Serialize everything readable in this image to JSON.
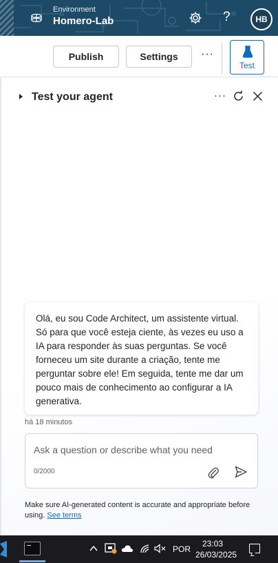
{
  "header": {
    "env_label": "Environment",
    "env_name": "Homero-Lab",
    "help_glyph": "?",
    "avatar_initials": "HB",
    "icons": {
      "environment": "globe-icon",
      "settings": "gear-icon",
      "help": "question-icon"
    }
  },
  "toolbar": {
    "publish_label": "Publish",
    "settings_label": "Settings",
    "more_glyph": "···",
    "test_label": "Test"
  },
  "panel": {
    "title": "Test your agent",
    "more_glyph": "···",
    "message": "Olá, eu sou Code Architect, um assistente virtual. Só para que você esteja ciente, às vezes eu uso a IA para responder às suas perguntas. Se você forneceu um site durante a criação, tente me perguntar sobre ele! Em seguida, tente me dar um pouco mais de conhecimento ao configurar a IA generativa.",
    "timestamp": "há 18 minutos",
    "input": {
      "placeholder": "Ask a question or describe what you need",
      "counter": "0/2000"
    },
    "disclaimer": "Make sure AI-generated content is accurate and appropriate before using.",
    "terms_link": "See terms"
  },
  "taskbar": {
    "language": "POR",
    "time": "23:03",
    "date": "26/03/2025",
    "tray_icons": [
      "chevron-up-icon",
      "shield-icon",
      "onedrive-icon",
      "wifi-icon",
      "volume-muted-icon"
    ]
  },
  "colors": {
    "accent": "#0f6cbd",
    "header_bg": "#1d4a66",
    "taskbar_bg": "#1b1b1f"
  }
}
